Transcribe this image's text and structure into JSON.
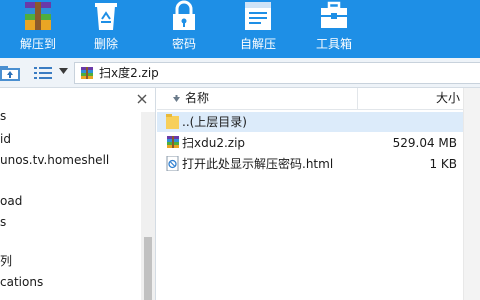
{
  "toolbar": {
    "buttons": [
      {
        "label": "解压到",
        "icon": "extract-to-icon"
      },
      {
        "label": "删除",
        "icon": "recycle-bin-icon"
      },
      {
        "label": "密码",
        "icon": "lock-icon"
      },
      {
        "label": "自解压",
        "icon": "self-extract-icon"
      },
      {
        "label": "工具箱",
        "icon": "toolbox-icon"
      }
    ]
  },
  "navbar": {
    "up_icon": "folder-up-icon",
    "view_icon": "list-view-icon",
    "path": "扫x度2.zip"
  },
  "sidebar": {
    "items": [
      {
        "label": "s"
      },
      {
        "label": "id"
      },
      {
        "label": "unos.tv.homeshell"
      },
      {
        "label": ""
      },
      {
        "label": "oad"
      },
      {
        "label": "s"
      },
      {
        "label": ""
      },
      {
        "label": "列"
      },
      {
        "label": "cations"
      }
    ]
  },
  "filelist": {
    "columns": {
      "name": "名称",
      "size": "大小"
    },
    "rows": [
      {
        "name": "..(上层目录)",
        "size": "",
        "icon": "folder-icon",
        "selected": true
      },
      {
        "name": "扫xdu2.zip",
        "size": "529.04 MB",
        "icon": "zip-archive-icon",
        "selected": false
      },
      {
        "name": "打开此处显示解压密码.html",
        "size": "1 KB",
        "icon": "html-file-icon",
        "selected": false
      }
    ]
  },
  "colors": {
    "toolbar_bg": "#1e8fe6",
    "selected_row": "#dcebfa"
  }
}
